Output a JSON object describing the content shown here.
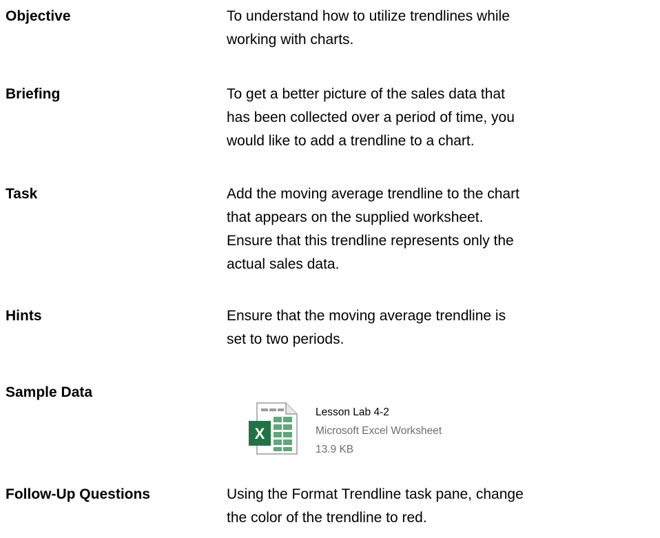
{
  "sections": [
    {
      "label": "Objective",
      "text": "To understand how to utilize trendlines while\nworking with charts."
    },
    {
      "label": "Briefing",
      "text": "To get a better picture of the sales data that\nhas been collected over a period of time, you\nwould like to add a trendline to a chart."
    },
    {
      "label": "Task",
      "text": "Add the moving average trendline to the chart\nthat appears on the supplied worksheet.\nEnsure that this trendline represents only the\nactual sales data."
    },
    {
      "label": "Hints",
      "text": "Ensure that the moving average trendline is\nset to two periods."
    },
    {
      "label": "Sample Data",
      "file": {
        "name": "Lesson Lab 4-2",
        "type": "Microsoft Excel Worksheet",
        "size": "13.9 KB",
        "icon": "excel-worksheet-icon"
      }
    },
    {
      "label": "Follow-Up Questions",
      "text": "Using the Format Trendline task pane, change\nthe color of the trendline to red."
    }
  ],
  "colors": {
    "excel_green": "#217346",
    "secondary_text": "#6d6d6d"
  }
}
